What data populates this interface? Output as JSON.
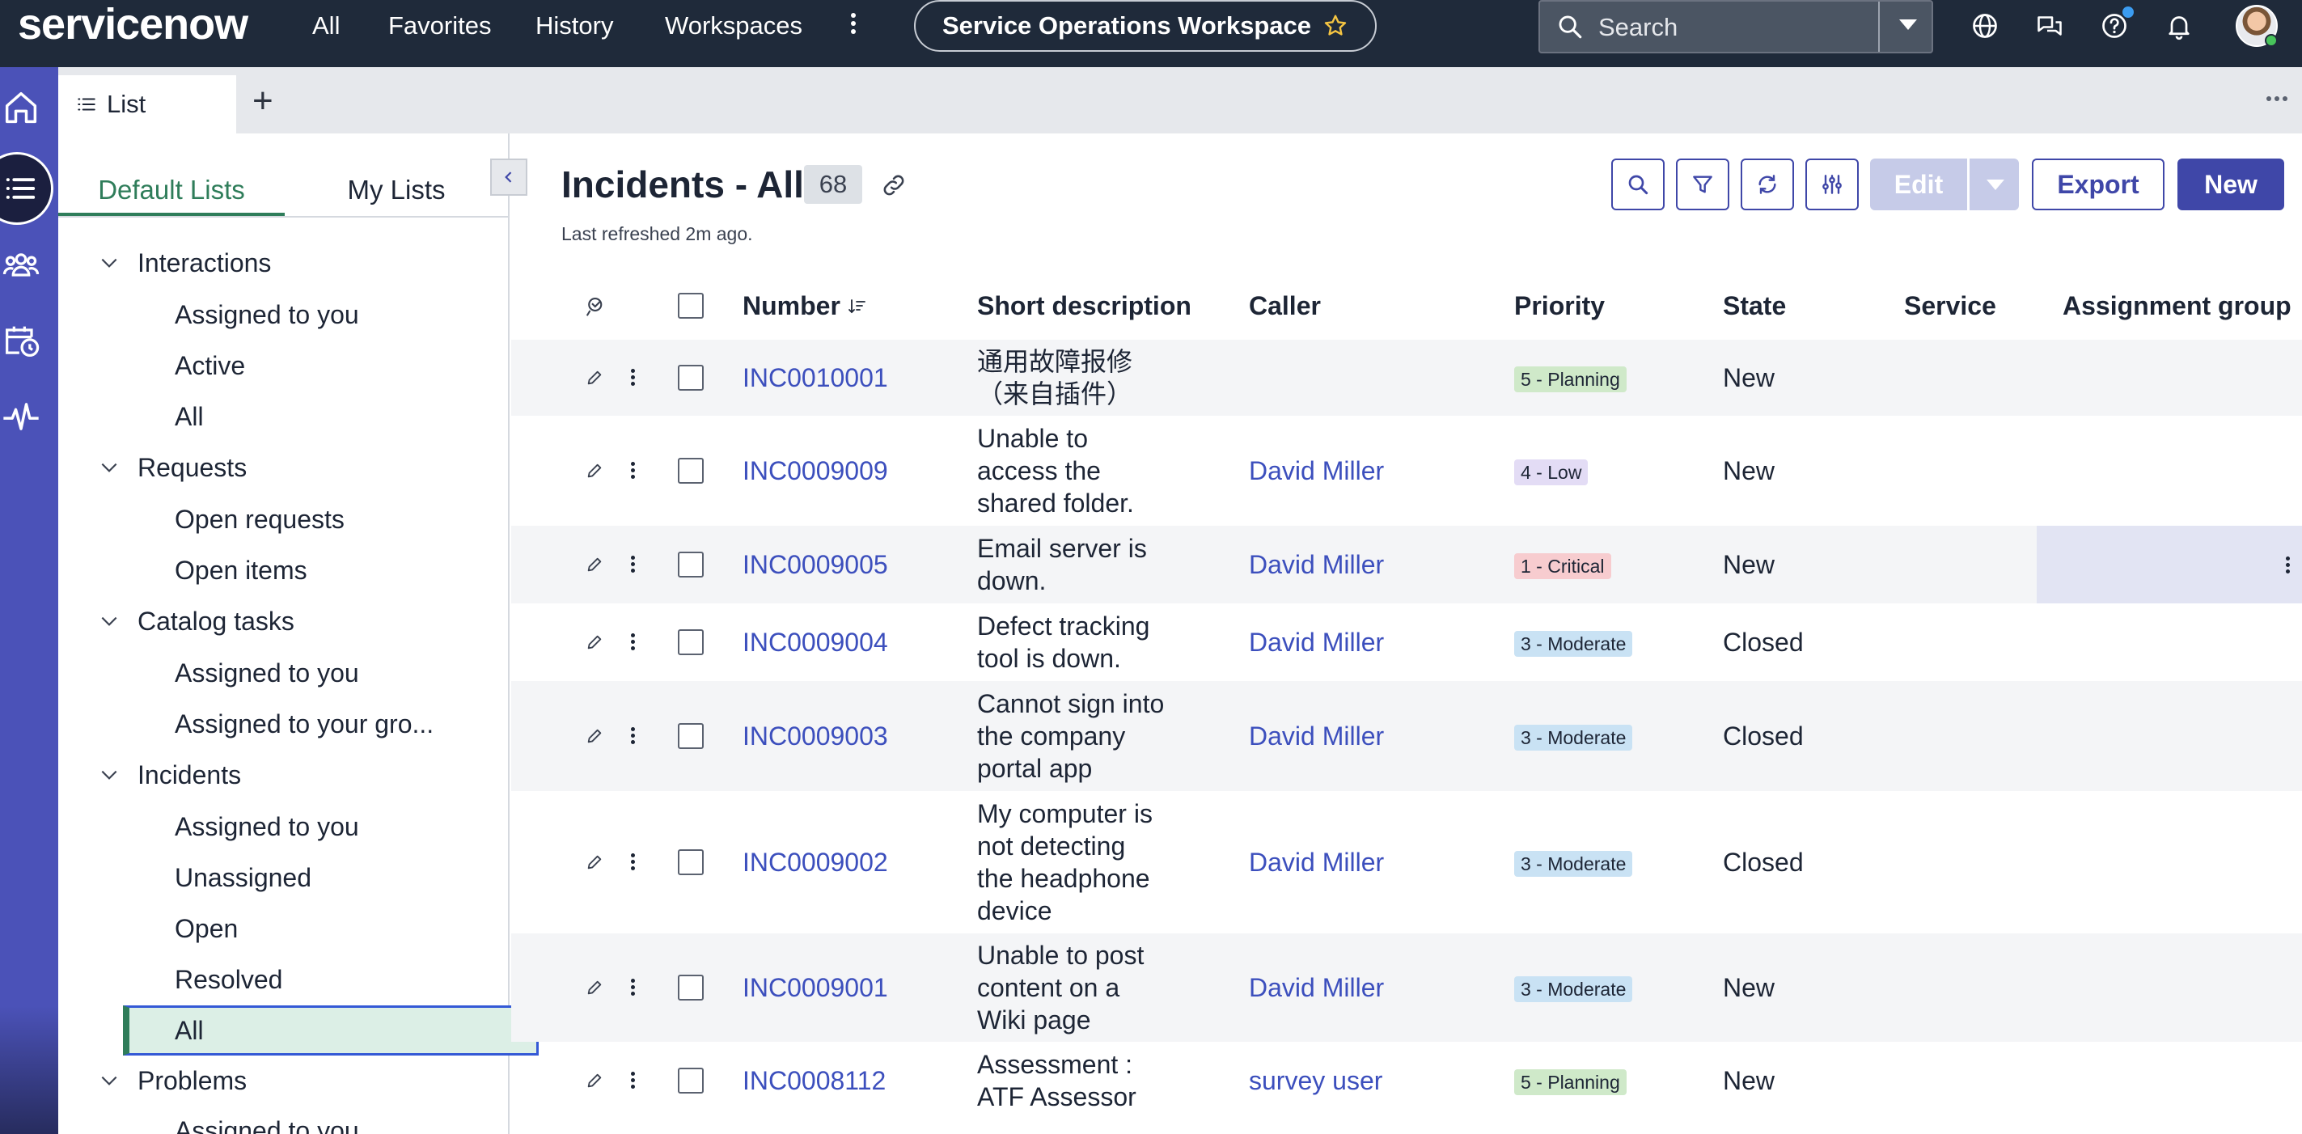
{
  "header": {
    "logo": "servicenow",
    "nav": [
      "All",
      "Favorites",
      "History",
      "Workspaces"
    ],
    "workspace_label": "Service Operations Workspace",
    "search_placeholder": "Search"
  },
  "tabs": {
    "active_label": "List"
  },
  "list_nav": {
    "tabs": [
      "Default Lists",
      "My Lists"
    ],
    "groups": [
      {
        "label": "Interactions",
        "items": [
          "Assigned to you",
          "Active",
          "All"
        ]
      },
      {
        "label": "Requests",
        "items": [
          "Open requests",
          "Open items"
        ]
      },
      {
        "label": "Catalog tasks",
        "items": [
          "Assigned to you",
          "Assigned to your gro..."
        ]
      },
      {
        "label": "Incidents",
        "items": [
          "Assigned to you",
          "Unassigned",
          "Open",
          "Resolved",
          "All"
        ]
      },
      {
        "label": "Problems",
        "items": [
          "Assigned to you"
        ]
      }
    ],
    "selected": "All"
  },
  "main": {
    "title": "Incidents - All",
    "count": "68",
    "refreshed": "Last refreshed 2m ago.",
    "buttons": {
      "edit": "Edit",
      "export": "Export",
      "new": "New"
    },
    "columns": [
      "Number",
      "Short description",
      "Caller",
      "Priority",
      "State",
      "Service",
      "Assignment group"
    ],
    "rows": [
      {
        "number": "INC0010001",
        "desc": [
          "通用故障报修",
          "（来自插件）"
        ],
        "caller": "",
        "priority": "5 - Planning",
        "state": "New"
      },
      {
        "number": "INC0009009",
        "desc": [
          "Unable to",
          "access the",
          "shared folder."
        ],
        "caller": "David Miller",
        "priority": "4 - Low",
        "state": "New"
      },
      {
        "number": "INC0009005",
        "desc": [
          "Email server is",
          "down."
        ],
        "caller": "David Miller",
        "priority": "1 - Critical",
        "state": "New"
      },
      {
        "number": "INC0009004",
        "desc": [
          "Defect tracking",
          "tool is down."
        ],
        "caller": "David Miller",
        "priority": "3 - Moderate",
        "state": "Closed"
      },
      {
        "number": "INC0009003",
        "desc": [
          "Cannot sign into",
          "the company",
          "portal app"
        ],
        "caller": "David Miller",
        "priority": "3 - Moderate",
        "state": "Closed"
      },
      {
        "number": "INC0009002",
        "desc": [
          "My computer is",
          "not detecting",
          "the headphone",
          "device"
        ],
        "caller": "David Miller",
        "priority": "3 - Moderate",
        "state": "Closed"
      },
      {
        "number": "INC0009001",
        "desc": [
          "Unable to post",
          "content on a",
          "Wiki page"
        ],
        "caller": "David Miller",
        "priority": "3 - Moderate",
        "state": "New"
      },
      {
        "number": "INC0008112",
        "desc": [
          "Assessment :",
          "ATF Assessor"
        ],
        "caller": "survey user",
        "priority": "5 - Planning",
        "state": "New"
      }
    ]
  },
  "colors": {
    "header_bg": "#1f2a3a",
    "rail_bg": "#4b52b8",
    "accent": "#3f47a8",
    "link": "#3c4fbd",
    "nav_active": "#2f7d5a",
    "priority_planning": "#cfe9c9",
    "priority_low": "#e3dcf5",
    "priority_critical": "#f7cccf",
    "priority_moderate": "#c9e2f4"
  }
}
